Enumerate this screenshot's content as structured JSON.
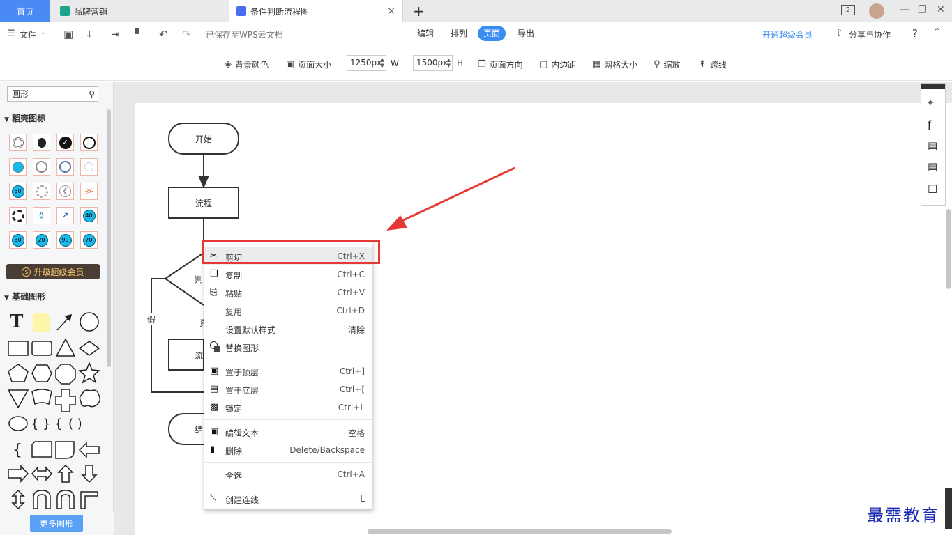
{
  "tabs": {
    "home": "首页",
    "brand": "品牌营销",
    "flow": "条件判断流程图",
    "add": "+",
    "close": "×"
  },
  "window": {
    "badge": "2"
  },
  "toolbar": {
    "file": "文件",
    "saved_status": "已保存至WPS云文档",
    "menu": [
      "编辑",
      "排列",
      "页面",
      "导出"
    ],
    "vip": "开通超级会员",
    "share": "分享与协作",
    "help": "?"
  },
  "pagebar": {
    "bg_color": "背景颜色",
    "page_size": "页面大小",
    "width_value": "1250px",
    "width_label": "W",
    "height_value": "1500px",
    "height_label": "H",
    "orientation": "页面方向",
    "padding": "内边距",
    "grid_size": "网格大小",
    "zoom": "缩放",
    "jump_line": "跨线"
  },
  "leftpanel": {
    "search_value": "圆形",
    "section1": "稻壳图标",
    "numbers": [
      "50",
      "40",
      "30",
      "20",
      "90",
      "70"
    ],
    "upgrade": "升级超级会员",
    "section2": "基础图形",
    "text_tool": "T",
    "more": "更多图形"
  },
  "flowchart": {
    "start": "开始",
    "process": "流程",
    "decision": "判",
    "false_label": "假",
    "true_label": "真",
    "process2": "流",
    "end": "结"
  },
  "context_menu": {
    "items": [
      {
        "label": "剪切",
        "key": "Ctrl+X"
      },
      {
        "label": "复制",
        "key": "Ctrl+C"
      },
      {
        "label": "粘贴",
        "key": "Ctrl+V"
      },
      {
        "label": "复用",
        "key": "Ctrl+D"
      },
      {
        "label": "设置默认样式",
        "key": "清除"
      },
      {
        "label": "替换图形",
        "key": ""
      },
      {
        "label": "置于顶层",
        "key": "Ctrl+]"
      },
      {
        "label": "置于底层",
        "key": "Ctrl+["
      },
      {
        "label": "锁定",
        "key": "Ctrl+L"
      },
      {
        "label": "编辑文本",
        "key": "空格"
      },
      {
        "label": "删除",
        "key": "Delete/Backspace"
      },
      {
        "label": "全选",
        "key": "Ctrl+A"
      },
      {
        "label": "创建连线",
        "key": "L"
      }
    ]
  },
  "watermark": "最需教育",
  "colors": {
    "accent": "#3b8cf0",
    "highlight": "#e53935",
    "vip_bg": "#4a3e34",
    "vip_text": "#f5c76b"
  }
}
